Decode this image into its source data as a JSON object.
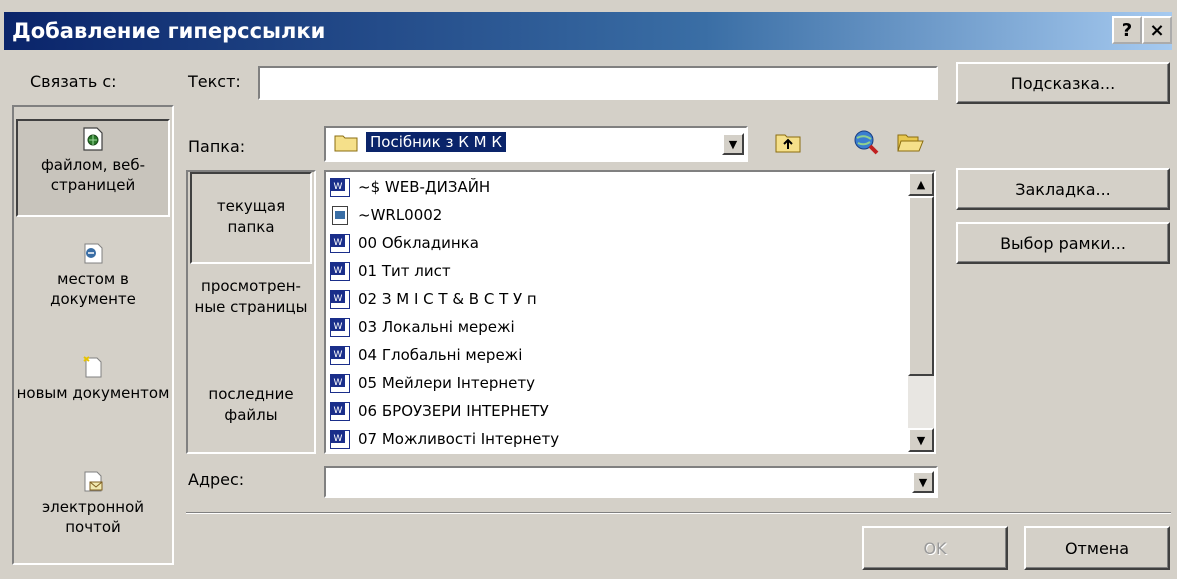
{
  "title": "Добавление гиперссылки",
  "title_buttons": {
    "help": "?",
    "close": "×"
  },
  "link_to": {
    "label": "Связать с:",
    "items": [
      {
        "label": "файлом, веб-страницей",
        "icon": "web-page-icon",
        "selected": true
      },
      {
        "label": "местом в документе",
        "icon": "place-in-document-icon"
      },
      {
        "label": "новым документом",
        "icon": "new-document-icon"
      },
      {
        "label": "электронной почтой",
        "icon": "email-icon"
      }
    ]
  },
  "text_field": {
    "label": "Текст:",
    "value": ""
  },
  "hint_button": "Подсказка...",
  "folder": {
    "label": "Папка:",
    "value": "Посібник з К М К"
  },
  "nav": [
    {
      "label": "текущая папка",
      "selected": true
    },
    {
      "label": "просмотрен-ные страницы"
    },
    {
      "label": "последние файлы"
    }
  ],
  "files": [
    {
      "name": "~$ WEB-ДИЗАЙН",
      "icon": "word-doc-icon"
    },
    {
      "name": "~WRL0002",
      "icon": "generic-file-icon"
    },
    {
      "name": "00 Обкладинка",
      "icon": "word-doc-icon"
    },
    {
      "name": "01 Тит лист",
      "icon": "word-doc-icon"
    },
    {
      "name": "02 З М І С Т & В С Т У п",
      "icon": "word-doc-icon"
    },
    {
      "name": "03 Локальні мережі",
      "icon": "word-doc-icon"
    },
    {
      "name": "04 Глобальні мережі",
      "icon": "word-doc-icon"
    },
    {
      "name": "05 Мейлери Інтернету",
      "icon": "word-doc-icon"
    },
    {
      "name": "06 БРОУЗЕРИ ІНТЕРНЕТУ",
      "icon": "word-doc-icon"
    },
    {
      "name": "07 Можливості Інтернету",
      "icon": "word-doc-icon"
    }
  ],
  "bookmark_button": "Закладка...",
  "frame_button": "Выбор рамки...",
  "address": {
    "label": "Адрес:",
    "value": ""
  },
  "ok_button": "OK",
  "cancel_button": "Отмена",
  "colors": {
    "title_start": "#0a246a",
    "title_end": "#a6caf0",
    "selection": "#0a246a",
    "face": "#d4d0c8"
  }
}
